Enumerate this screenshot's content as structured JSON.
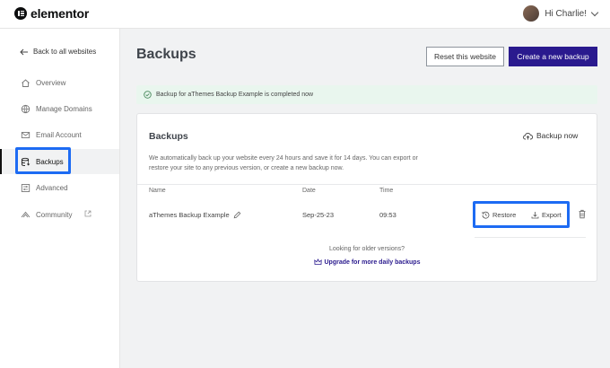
{
  "brand": {
    "name": "elementor"
  },
  "user": {
    "greeting": "Hi Charlie!"
  },
  "sidebar": {
    "back_label": "Back to all websites",
    "items": [
      {
        "label": "Overview",
        "icon": "home-icon"
      },
      {
        "label": "Manage Domains",
        "icon": "globe-icon"
      },
      {
        "label": "Email Account",
        "icon": "mail-icon"
      },
      {
        "label": "Backups",
        "icon": "database-icon",
        "active": true
      },
      {
        "label": "Advanced",
        "icon": "sliders-icon"
      },
      {
        "label": "Community",
        "icon": "community-icon"
      }
    ]
  },
  "header": {
    "title": "Backups",
    "reset_label": "Reset this website",
    "create_label": "Create a new backup"
  },
  "alert": {
    "text": "Backup for aThemes Backup Example is completed now"
  },
  "card": {
    "title": "Backups",
    "backup_now_label": "Backup now",
    "description": "We automatically back up your website every 24 hours and save it for 14 days. You can export or restore your site to any previous version, or create a new backup now.",
    "columns": {
      "name": "Name",
      "date": "Date",
      "time": "Time"
    },
    "rows": [
      {
        "name": "aThemes Backup Example",
        "date": "Sep-25-23",
        "time": "09:53",
        "restore": "Restore",
        "export": "Export"
      }
    ],
    "older_text": "Looking for older versions?",
    "upgrade_label": "Upgrade for more daily backups"
  },
  "colors": {
    "accent": "#2a1a8e",
    "highlight": "#1d6bf3",
    "success_bg": "#e9f6ee"
  }
}
